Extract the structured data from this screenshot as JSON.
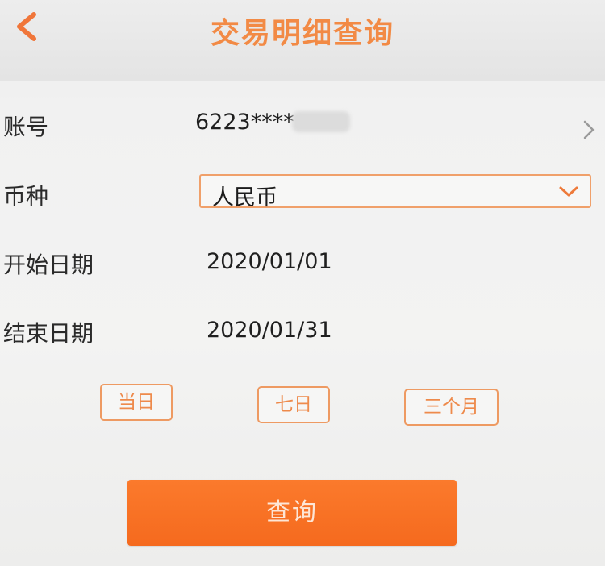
{
  "header": {
    "title": "交易明细查询",
    "back_icon": "chevron-left-icon"
  },
  "form": {
    "account": {
      "label": "账号",
      "value": "6223****",
      "chevron_icon": "chevron-right-icon"
    },
    "currency": {
      "label": "币种",
      "selected": "人民币",
      "dropdown_icon": "chevron-down-icon"
    },
    "start_date": {
      "label": "开始日期",
      "value": "2020/01/01"
    },
    "end_date": {
      "label": "结束日期",
      "value": "2020/01/31"
    }
  },
  "quick_ranges": {
    "today": "当日",
    "seven_days": "七日",
    "three_months": "三个月"
  },
  "actions": {
    "query_label": "查询"
  },
  "colors": {
    "accent": "#f28a45",
    "button_fill": "#f56a1e",
    "border": "#ee9a62"
  }
}
